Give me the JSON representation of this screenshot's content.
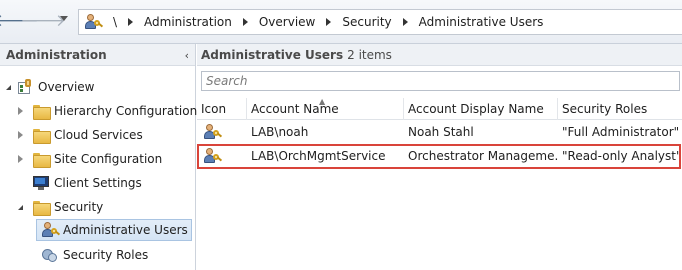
{
  "breadcrumb": {
    "root": "\\",
    "items": [
      "Administration",
      "Overview",
      "Security",
      "Administrative Users"
    ]
  },
  "nav": {
    "header": "Administration",
    "collapse_glyph": "‹",
    "items": [
      {
        "label": "Overview",
        "icon": "overview-icon",
        "expander": "open"
      },
      {
        "label": "Hierarchy Configuration",
        "icon": "folder-icon",
        "expander": "closed"
      },
      {
        "label": "Cloud Services",
        "icon": "folder-icon",
        "expander": "closed"
      },
      {
        "label": "Site Configuration",
        "icon": "folder-icon",
        "expander": "closed"
      },
      {
        "label": "Client Settings",
        "icon": "monitor-icon",
        "expander": "none"
      },
      {
        "label": "Security",
        "icon": "folder-icon",
        "expander": "open"
      },
      {
        "label": "Administrative Users",
        "icon": "user-key-icon",
        "expander": "none",
        "selected": true
      },
      {
        "label": "Security Roles",
        "icon": "security-roles-icon",
        "expander": "none"
      }
    ]
  },
  "main": {
    "title": "Administrative Users",
    "count": "2 items",
    "search_placeholder": "Search",
    "columns": [
      "Icon",
      "Account Name",
      "Account Display Name",
      "Security Roles"
    ],
    "rows": [
      {
        "icon": "user-key-icon",
        "account": "LAB\\noah",
        "display": "Noah Stahl",
        "roles": "\"Full Administrator\""
      },
      {
        "icon": "user-key-icon",
        "account": "LAB\\OrchMgmtService",
        "display": "Orchestrator Manageme...",
        "roles": "\"Read-only Analyst\"",
        "highlighted": true
      }
    ]
  },
  "colors": {
    "highlight_border": "#d9443a",
    "selected_bg": "#d4e4f5",
    "folder": "#e8b844"
  }
}
